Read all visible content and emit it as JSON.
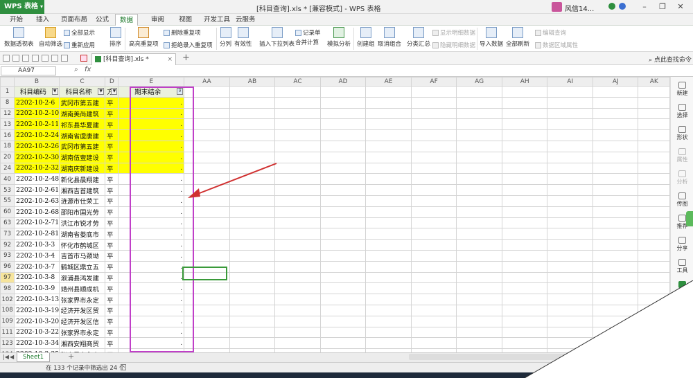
{
  "app": {
    "logo_label": "WPS 表格",
    "title": "[科目查询].xls * [兼容模式] - WPS 表格",
    "user_name": "风信14..."
  },
  "menu": [
    "开始",
    "插入",
    "页面布局",
    "公式",
    "数据",
    "审阅",
    "视图",
    "开发工具",
    "云服务"
  ],
  "menu_active": "数据",
  "ribbon": {
    "big": [
      "数据透视表",
      "自动筛选",
      "排序",
      "高亮重复项",
      "分列",
      "有效性",
      "插入下拉列表",
      "合并计算",
      "模拟分析",
      "创建组",
      "取消组合",
      "分类汇总",
      "导入数据",
      "全部刷新"
    ],
    "small": [
      "全部显示",
      "重新应用",
      "删除重复项",
      "拒绝录入重复项",
      "记录单",
      "显示明细数据",
      "隐藏明细数据",
      "编辑查询",
      "数据区域属性"
    ]
  },
  "doc_tab": {
    "label": "[科目查询].xls *"
  },
  "command_search": "点此查找命令",
  "name_box": "AA97",
  "fx": "fx",
  "columns": [
    "B",
    "C",
    "D",
    "E",
    "AA",
    "AB",
    "AC",
    "AD",
    "AE",
    "AF",
    "AG",
    "AH",
    "AI",
    "AJ",
    "AK"
  ],
  "header_row": {
    "row": "1",
    "b": "科目编码",
    "c": "科目名称",
    "d": "方",
    "e": "期末结余"
  },
  "rows": [
    {
      "r": "8",
      "b": "2202-10-2-6",
      "c": "武冈市第五建",
      "d": "平",
      "hl": true
    },
    {
      "r": "12",
      "b": "2202-10-2-10",
      "c": "湖南美尚建筑",
      "d": "平",
      "hl": true
    },
    {
      "r": "13",
      "b": "2202-10-2-11",
      "c": "祁东县华夏建",
      "d": "平",
      "hl": true
    },
    {
      "r": "16",
      "b": "2202-10-2-24",
      "c": "湖南省虞唐建",
      "d": "平",
      "hl": true
    },
    {
      "r": "18",
      "b": "2202-10-2-26",
      "c": "武冈市第五建",
      "d": "平",
      "hl": true
    },
    {
      "r": "20",
      "b": "2202-10-2-30",
      "c": "湖南伍壹建设",
      "d": "平",
      "hl": true
    },
    {
      "r": "24",
      "b": "2202-10-2-32",
      "c": "湖南庆新建设",
      "d": "平",
      "hl": true
    },
    {
      "r": "40",
      "b": "2202-10-2-48",
      "c": "新化县晨翔建",
      "d": "平",
      "hl": false
    },
    {
      "r": "53",
      "b": "2202-10-2-61",
      "c": "湘西吉首建筑",
      "d": "平",
      "hl": false
    },
    {
      "r": "55",
      "b": "2202-10-2-63",
      "c": "涟源市仕荣工",
      "d": "平",
      "hl": false
    },
    {
      "r": "60",
      "b": "2202-10-2-68",
      "c": "邵阳市国光劳",
      "d": "平",
      "hl": false
    },
    {
      "r": "63",
      "b": "2202-10-2-71",
      "c": "洪江市锐才劳",
      "d": "平",
      "hl": false
    },
    {
      "r": "73",
      "b": "2202-10-2-81",
      "c": "湖南省娄底市",
      "d": "平",
      "hl": false
    },
    {
      "r": "92",
      "b": "2202-10-3-3",
      "c": "怀化市鹤城区",
      "d": "平",
      "hl": false
    },
    {
      "r": "93",
      "b": "2202-10-3-4",
      "c": "吉首市马颈坳",
      "d": "平",
      "hl": false
    },
    {
      "r": "96",
      "b": "2202-10-3-7",
      "c": "鹤城区鼎立五",
      "d": "平",
      "hl": false
    },
    {
      "r": "97",
      "b": "2202-10-3-8",
      "c": "溆浦县鸿发建",
      "d": "平",
      "hl": false
    },
    {
      "r": "98",
      "b": "2202-10-3-9",
      "c": "靖州县顺成机",
      "d": "平",
      "hl": false
    },
    {
      "r": "102",
      "b": "2202-10-3-13",
      "c": "张家界市永定",
      "d": "平",
      "hl": false
    },
    {
      "r": "108",
      "b": "2202-10-3-19",
      "c": "经济开发区贸",
      "d": "平",
      "hl": false
    },
    {
      "r": "109",
      "b": "2202-10-3-20",
      "c": "经济开发区信",
      "d": "平",
      "hl": false
    },
    {
      "r": "111",
      "b": "2202-10-3-22",
      "c": "张家界市永定",
      "d": "平",
      "hl": false
    },
    {
      "r": "123",
      "b": "2202-10-3-34",
      "c": "湘西安翔商贸",
      "d": "平",
      "hl": false
    },
    {
      "r": "124",
      "b": "2202-10-3-35",
      "c": "张家界市永定",
      "d": "平",
      "hl": false
    }
  ],
  "e_value": ".",
  "sidebar": [
    "新建",
    "选择",
    "形状",
    "属性",
    "分析",
    "传图",
    "推荐",
    "分享",
    "工具",
    "备份"
  ],
  "sheet_tab": "Sheet1",
  "status": "在 133 个记录中筛选出 24 个",
  "colors": {
    "highlight": "#ffff00",
    "filter_header": "#ebf1de",
    "annotation": "#c03fc8",
    "arrow": "#d03030",
    "active_cell": "#3a9a3a",
    "brand": "#2f8f3f"
  }
}
